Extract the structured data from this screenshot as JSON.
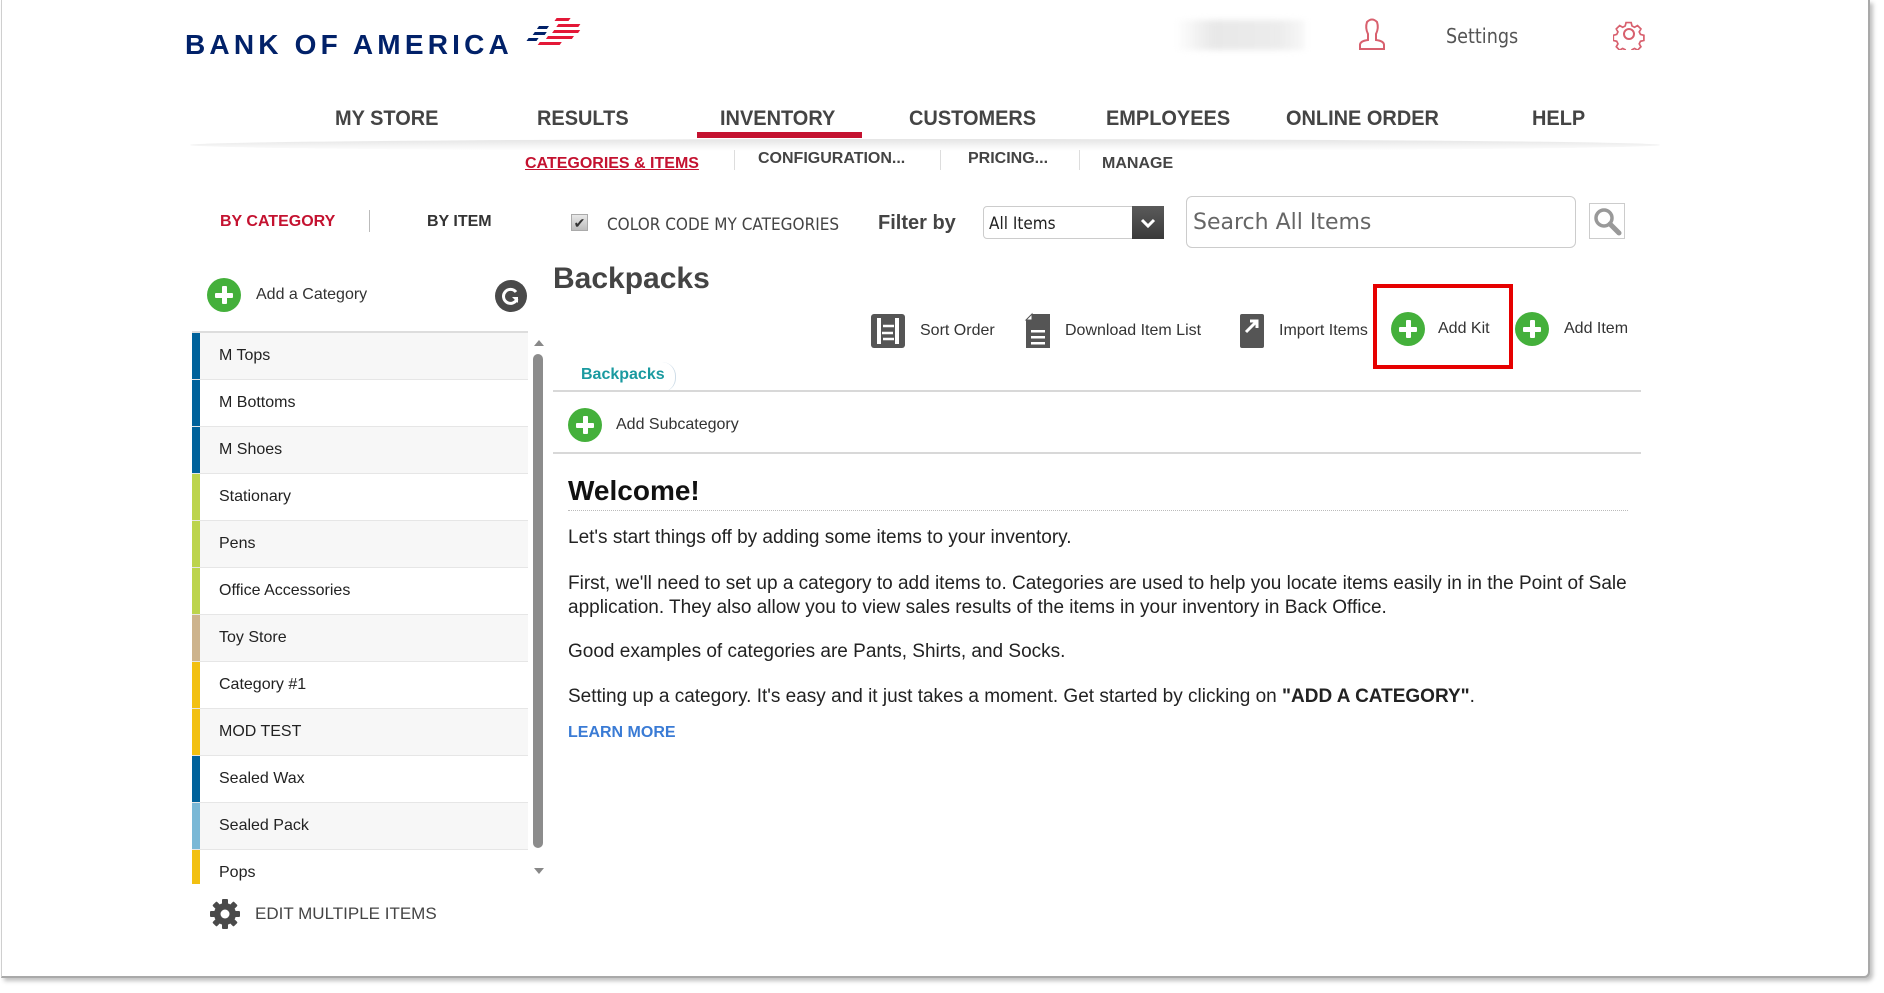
{
  "header": {
    "brand": "BANK OF AMERICA",
    "user_name": "",
    "settings_label": "Settings",
    "icons": {
      "user": "user-icon",
      "settings": "gear-icon"
    }
  },
  "nav": {
    "items": [
      {
        "label": "MY STORE"
      },
      {
        "label": "RESULTS"
      },
      {
        "label": "INVENTORY",
        "active": true
      },
      {
        "label": "CUSTOMERS"
      },
      {
        "label": "EMPLOYEES"
      },
      {
        "label": "ONLINE ORDER"
      },
      {
        "label": "HELP"
      }
    ],
    "accent": "#c41230"
  },
  "subnav": {
    "items": [
      {
        "label": "CATEGORIES & ITEMS",
        "active": true
      },
      {
        "label": "CONFIGURATION..."
      },
      {
        "label": "PRICING..."
      },
      {
        "label": "MANAGE"
      }
    ]
  },
  "view_tabs": {
    "by_category": "BY CATEGORY",
    "by_item": "BY ITEM"
  },
  "filters": {
    "color_code_label": "COLOR CODE MY CATEGORIES",
    "color_code_checked": true,
    "filter_label": "Filter by",
    "filter_value": "All Items",
    "search_placeholder": "Search All Items",
    "search_value": ""
  },
  "sidebar": {
    "add_category_label": "Add a Category",
    "categories": [
      {
        "label": "M Tops",
        "color": "#00629b"
      },
      {
        "label": "M Bottoms",
        "color": "#00629b"
      },
      {
        "label": "M Shoes",
        "color": "#00629b"
      },
      {
        "label": "Stationary",
        "color": "#bcd44c"
      },
      {
        "label": "Pens",
        "color": "#bcd44c"
      },
      {
        "label": "Office Accessories",
        "color": "#bcd44c"
      },
      {
        "label": "Toy Store",
        "color": "#cdb38c"
      },
      {
        "label": "Category #1",
        "color": "#f2c011"
      },
      {
        "label": "MOD TEST",
        "color": "#f2c011"
      },
      {
        "label": "Sealed Wax",
        "color": "#00629b"
      },
      {
        "label": "Sealed Pack",
        "color": "#7ab8d6"
      },
      {
        "label": "Pops",
        "color": "#f2c011"
      }
    ],
    "edit_multiple_label": "EDIT MULTIPLE ITEMS"
  },
  "main": {
    "category_title": "Backpacks",
    "toolbar": {
      "sort_order": "Sort Order",
      "download_list": "Download Item List",
      "import_items": "Import Items",
      "add_kit": "Add Kit",
      "add_item": "Add Item"
    },
    "subcategory_tab": "Backpacks",
    "add_subcategory": "Add Subcategory",
    "welcome": {
      "title": "Welcome!",
      "p1": "Let's start things off by adding some items to your inventory.",
      "p2": "First, we'll need to set up a category to add items to. Categories are used to help you locate items easily in in the Point of Sale application. They also allow you to view sales results of the items in your inventory in Back Office.",
      "p3": "Good examples of categories are Pants, Shirts, and Socks.",
      "p4_prefix": "Setting up a category. It's easy and it just takes a moment. Get started by clicking on ",
      "p4_bold": "\"ADD A CATEGORY\"",
      "p4_suffix": ".",
      "learn_more": "LEARN MORE"
    }
  },
  "colors": {
    "brand_blue": "#012169",
    "brand_red": "#e31837",
    "accent_red": "#c41230",
    "add_green": "#44b03b",
    "teal": "#1a9aa0",
    "link_blue": "#3a7bd5",
    "highlight": "#e60000"
  }
}
